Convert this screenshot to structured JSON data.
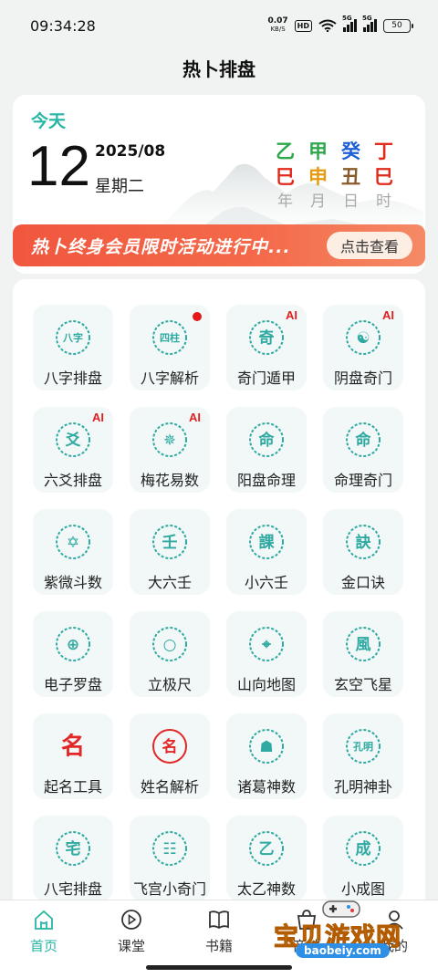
{
  "status_bar": {
    "time": "09:34:28",
    "net_speed": "0.07",
    "net_unit": "KB/S",
    "hd": "HD",
    "signal_label": "5G",
    "battery": "50"
  },
  "header": {
    "title": "热卜排盘"
  },
  "date_card": {
    "today_label": "今天",
    "day": "12",
    "year_month": "2025/08",
    "weekday": "星期二",
    "ganzhi": [
      {
        "stem": "乙",
        "branch": "巳",
        "label": "年",
        "stem_color": "#2ca84a",
        "branch_color": "#e02a1b"
      },
      {
        "stem": "甲",
        "branch": "申",
        "label": "月",
        "stem_color": "#2ca84a",
        "branch_color": "#e59a10"
      },
      {
        "stem": "癸",
        "branch": "丑",
        "label": "日",
        "stem_color": "#1f5fd6",
        "branch_color": "#8b5a2b"
      },
      {
        "stem": "丁",
        "branch": "巳",
        "label": "时",
        "stem_color": "#e02a1b",
        "branch_color": "#e02a1b"
      }
    ]
  },
  "promo": {
    "text": "热卜终身会员限时活动进行中...",
    "button_label": "点击查看"
  },
  "tools": [
    {
      "label": "八字排盘",
      "icon": "bazi-paipan-icon",
      "glyph": "八字",
      "badge": ""
    },
    {
      "label": "八字解析",
      "icon": "bazi-jiexi-icon",
      "glyph": "四柱",
      "badge": "dot"
    },
    {
      "label": "奇门遁甲",
      "icon": "qimen-dunjia-icon",
      "glyph": "奇",
      "badge": "AI"
    },
    {
      "label": "阴盘奇门",
      "icon": "yinpan-qimen-icon",
      "glyph": "☯",
      "badge": "AI"
    },
    {
      "label": "六爻排盘",
      "icon": "liuyao-icon",
      "glyph": "爻",
      "badge": "AI"
    },
    {
      "label": "梅花易数",
      "icon": "meihua-icon",
      "glyph": "✵",
      "badge": "AI"
    },
    {
      "label": "阳盘命理",
      "icon": "yangpan-mingli-icon",
      "glyph": "命",
      "badge": ""
    },
    {
      "label": "命理奇门",
      "icon": "mingli-qimen-icon",
      "glyph": "命",
      "badge": ""
    },
    {
      "label": "紫微斗数",
      "icon": "ziwei-icon",
      "glyph": "✡",
      "badge": ""
    },
    {
      "label": "大六壬",
      "icon": "daliuren-icon",
      "glyph": "壬",
      "badge": ""
    },
    {
      "label": "小六壬",
      "icon": "xiaoliuren-icon",
      "glyph": "課",
      "badge": ""
    },
    {
      "label": "金口诀",
      "icon": "jinkoujue-icon",
      "glyph": "訣",
      "badge": ""
    },
    {
      "label": "电子罗盘",
      "icon": "compass-icon",
      "glyph": "⊕",
      "badge": ""
    },
    {
      "label": "立极尺",
      "icon": "liji-ruler-icon",
      "glyph": "○",
      "badge": ""
    },
    {
      "label": "山向地图",
      "icon": "map-pin-icon",
      "glyph": "⌖",
      "badge": ""
    },
    {
      "label": "玄空飞星",
      "icon": "xuankong-icon",
      "glyph": "風",
      "badge": ""
    },
    {
      "label": "起名工具",
      "icon": "naming-icon",
      "glyph": "名",
      "badge": ""
    },
    {
      "label": "姓名解析",
      "icon": "name-analysis-icon",
      "glyph": "名",
      "badge": ""
    },
    {
      "label": "诸葛神数",
      "icon": "zhuge-icon",
      "glyph": "☗",
      "badge": ""
    },
    {
      "label": "孔明神卦",
      "icon": "kongming-icon",
      "glyph": "孔明",
      "badge": ""
    },
    {
      "label": "八宅排盘",
      "icon": "bazhai-icon",
      "glyph": "宅",
      "badge": ""
    },
    {
      "label": "飞宫小奇门",
      "icon": "feigong-icon",
      "glyph": "☷",
      "badge": ""
    },
    {
      "label": "太乙神数",
      "icon": "taiyi-icon",
      "glyph": "乙",
      "badge": ""
    },
    {
      "label": "小成图",
      "icon": "xiaochengtu-icon",
      "glyph": "成",
      "badge": ""
    }
  ],
  "tabbar": {
    "items": [
      {
        "label": "首页",
        "icon": "home-icon",
        "active": true
      },
      {
        "label": "课堂",
        "icon": "play-circle-icon",
        "active": false
      },
      {
        "label": "书籍",
        "icon": "book-icon",
        "active": false
      },
      {
        "label": "商城",
        "icon": "shop-icon",
        "active": false
      },
      {
        "label": "我的",
        "icon": "user-icon",
        "active": false
      }
    ]
  },
  "watermark": {
    "text": "宝贝游戏网",
    "url": "baobeiy.com"
  },
  "colors": {
    "accent": "#27b5a6",
    "icon_teal": "#2fa9a1",
    "badge_red": "#e21f1f"
  }
}
